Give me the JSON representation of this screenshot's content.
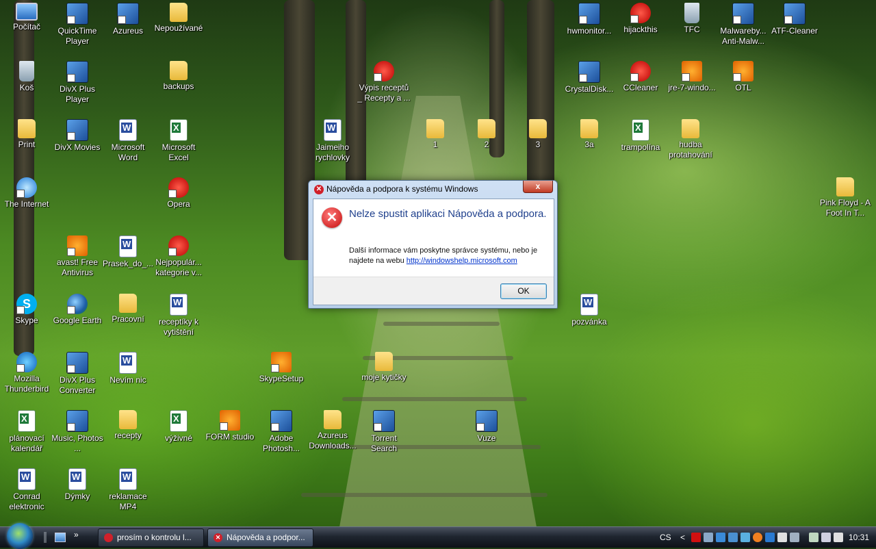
{
  "desktop": {
    "icons": [
      {
        "label": "Počítač",
        "kind": "pc"
      },
      {
        "label": "QuickTime Player",
        "kind": "app"
      },
      {
        "label": "Azureus",
        "kind": "app"
      },
      {
        "label": "Nepoužívané",
        "kind": "folder"
      },
      {
        "label": "Koš",
        "kind": "bin"
      },
      {
        "label": "DivX Plus Player",
        "kind": "app"
      },
      {
        "label": "backups",
        "kind": "folder"
      },
      {
        "label": "Výpis receptů _ Recepty a ...",
        "kind": "red"
      },
      {
        "label": "Print",
        "kind": "folder"
      },
      {
        "label": "DivX Movies",
        "kind": "app"
      },
      {
        "label": "Microsoft Word",
        "kind": "doc"
      },
      {
        "label": "Microsoft Excel",
        "kind": "xls"
      },
      {
        "label": "Jaimeiho rychlovky",
        "kind": "doc"
      },
      {
        "label": "1",
        "kind": "folder"
      },
      {
        "label": "2",
        "kind": "folder"
      },
      {
        "label": "3",
        "kind": "folder"
      },
      {
        "label": "3a",
        "kind": "folder"
      },
      {
        "label": "trampolína",
        "kind": "xls"
      },
      {
        "label": "hudba protahování",
        "kind": "folder"
      },
      {
        "label": "The Internet",
        "kind": "ie"
      },
      {
        "label": "Opera",
        "kind": "red"
      },
      {
        "label": "Pink Floyd - A Foot In T...",
        "kind": "folder"
      },
      {
        "label": "avast! Free Antivirus",
        "kind": "orange"
      },
      {
        "label": "Prasek_do_...",
        "kind": "doc"
      },
      {
        "label": "Nejpopulár... kategorie v...",
        "kind": "red"
      },
      {
        "label": "Skype",
        "kind": "skype"
      },
      {
        "label": "Google Earth",
        "kind": "earth"
      },
      {
        "label": "Pracovní",
        "kind": "folder"
      },
      {
        "label": "receptíky k vytištění",
        "kind": "doc"
      },
      {
        "label": "pozvánka",
        "kind": "doc"
      },
      {
        "label": "Mozilla Thunderbird",
        "kind": "blue-round"
      },
      {
        "label": "DivX Plus Converter",
        "kind": "app"
      },
      {
        "label": "Nevím nic",
        "kind": "doc"
      },
      {
        "label": "SkypeSetup",
        "kind": "orange"
      },
      {
        "label": "moje kytičky",
        "kind": "folder"
      },
      {
        "label": "plánovací kalendář",
        "kind": "xls"
      },
      {
        "label": "Music, Photos ...",
        "kind": "app"
      },
      {
        "label": "recepty",
        "kind": "folder"
      },
      {
        "label": "výživné",
        "kind": "xls"
      },
      {
        "label": "FORM studio",
        "kind": "orange"
      },
      {
        "label": "Adobe Photosh...",
        "kind": "app"
      },
      {
        "label": "Azureus Downloads...",
        "kind": "folder"
      },
      {
        "label": "Torrent Search",
        "kind": "app"
      },
      {
        "label": "Vuze",
        "kind": "app"
      },
      {
        "label": "Conrad elektronic",
        "kind": "doc"
      },
      {
        "label": "Dýmky",
        "kind": "doc"
      },
      {
        "label": "reklamace MP4",
        "kind": "doc"
      },
      {
        "label": "hwmonitor...",
        "kind": "app"
      },
      {
        "label": "hijackthis",
        "kind": "red"
      },
      {
        "label": "TFC",
        "kind": "bin"
      },
      {
        "label": "Malwareby... Anti-Malw...",
        "kind": "app"
      },
      {
        "label": "ATF-Cleaner",
        "kind": "app"
      },
      {
        "label": "CrystalDisk...",
        "kind": "app"
      },
      {
        "label": "CCleaner",
        "kind": "red"
      },
      {
        "label": "jre-7-windo...",
        "kind": "orange"
      },
      {
        "label": "OTL",
        "kind": "orange"
      }
    ]
  },
  "dialog": {
    "title": "Nápověda a podpora k systému Windows",
    "close_glyph": "x",
    "main_instruction": "Nelze spustit aplikaci Nápověda a podpora.",
    "content_prefix": "Další informace vám poskytne správce systému, nebo je najdete na webu ",
    "link": "http://windowshelp.microsoft.com",
    "ok_label": "OK",
    "error_icon_glyph": "✕"
  },
  "taskbar": {
    "buttons": [
      {
        "label": "prosím o kontrolu l..."
      },
      {
        "label": "Nápověda a podpor..."
      }
    ],
    "quicklaunch_more": "»",
    "language": "CS",
    "tray_arrow": "<",
    "clock": "10:31"
  }
}
